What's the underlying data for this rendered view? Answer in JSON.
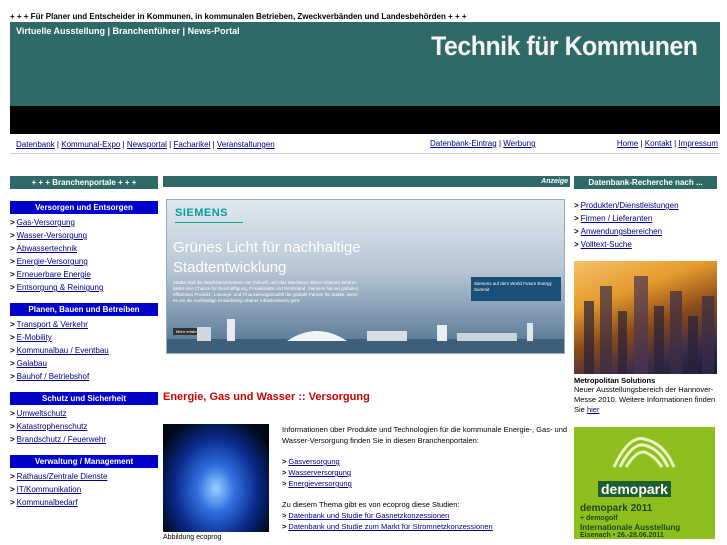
{
  "tagline": "+ + + Für Planer und Entscheider in Kommunen, in kommunalen Betrieben, Zweckverbänden und Landesbehörden + + +",
  "header": {
    "topnav": "Virtuelle Ausstellung | Branchenführer | News-Portal",
    "brand": "Technik für Kommunen"
  },
  "linkbar": {
    "left": [
      "Datenbank",
      "Kommunal-Expo",
      "Newsportal",
      "Facharikel",
      "Veranstaltungen"
    ],
    "mid": [
      "Datenbank-Eintrag",
      "Werbung"
    ],
    "right": [
      "Home",
      "Kontakt",
      "Impressum"
    ]
  },
  "left": {
    "portal_head": "+ + + Branchenportale + + +",
    "sections": [
      {
        "title": "Versorgen und Entsorgen",
        "items": [
          "Gas-Versorgung",
          "Wasser-Versorgung",
          "Abwassertechnik",
          "Energie-Versorgung",
          "Erneuerbare Energie",
          "Entsorgung & Reinigung"
        ]
      },
      {
        "title": "Planen, Bauen und Betreiben",
        "items": [
          "Transport & Verkehr",
          "E-Mobility",
          "Kommunalbau / Eventbau",
          "Galabau",
          "Bauhof / Betriebshof"
        ]
      },
      {
        "title": "Schutz und Sicherheit",
        "items": [
          "Umweltschutz",
          "Katastrophenschutz",
          "Brandschutz / Feuerwehr"
        ]
      },
      {
        "title": "Verwaltung / Management",
        "items": [
          "Rathaus/Zentrale Dienste",
          "IT/Kommunikation",
          "Kommunalbedarf"
        ]
      }
    ]
  },
  "middle": {
    "ticker": "Anzeige",
    "ad": {
      "logo": "SIEMENS",
      "headline": "Grünes Licht für nachhaltige Stadtentwicklung",
      "body": "Städte sind die Wachstumsmotoren der Zukunft, und das Wachstum dieser urbanen Zentren bietet eine Chance für Beschäftigung, Produktivität und Wohlstand. Siemens hat ein globales, effizientes Produkt-, Lösungs- und Finanzierungsmodell der globale Partner für Städte, wenn es um die nachhaltige Entwicklung urbaner Infrastrukturen geht.",
      "button": "Mehr erfahren",
      "summit": "Siemens auf dem World Future Energy Summit"
    },
    "section_title": "Energie, Gas und Wasser :: Versorgung",
    "image_caption": "Abbildung ecoprog",
    "intro": "Informationen über Produkte und Technologien für die kommunale Energie-, Gas- und Wasser-Versorgung finden Sie in diesen Branchenportalen:",
    "portal_links": [
      "Gasversorgung",
      "Wasserversorgung",
      "Energieversorgung"
    ],
    "studies_intro": "Zu diesem Thema gibt es von ecoprog diese Studien:",
    "study_links": [
      "Datenbank und Studie für Gasnetzkonzessionen",
      "Datenbank und Studie zum Markt für Stromnetzkonzessionen"
    ]
  },
  "right": {
    "head": "Datenbank-Recherche nach ...",
    "items": [
      "Produkten/Dienstleistungen",
      "Firmen / Lieferanten",
      "Anwendungsbereichen",
      "Volltext-Suche"
    ],
    "city_title": "Metropolitan Solutions",
    "city_text": "Neuer Ausstellungsbereich der Hannover-Messe 2010. Weitere Informationen finden Sie ",
    "city_link": "hier",
    "demopark": {
      "brand": "demopark",
      "year": "demopark 2011",
      "sub": "+ demogolf",
      "int": "Internationale Ausstellung",
      "date": "Eisenach • 26.-28.06.2011"
    }
  },
  "colors": {
    "teal": "#2f6a68",
    "blue": "#0000c8",
    "link": "#000080",
    "title_red": "#cc0000"
  }
}
